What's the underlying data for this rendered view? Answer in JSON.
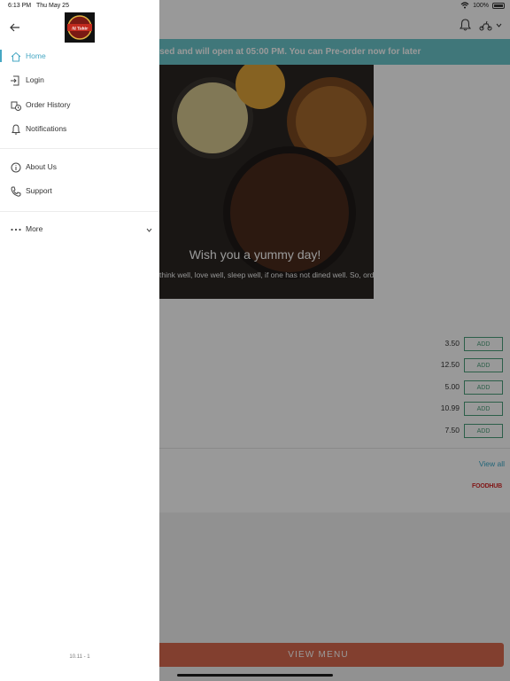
{
  "status_bar": {
    "time": "6:13 PM",
    "date": "Thu May 25",
    "battery": "100%"
  },
  "banner": {
    "text": "osed and will open at 05:00 PM. You can Pre-order now for later"
  },
  "hero": {
    "title": "Wish you a yummy day!",
    "subtitle": "think well, love well, sleep well, if one has not dined well. So, ord"
  },
  "menu_items": [
    {
      "price": "3.50",
      "button": "ADD"
    },
    {
      "price": "12.50",
      "button": "ADD"
    },
    {
      "price": "5.00",
      "button": "ADD"
    },
    {
      "price": "10.99",
      "button": "ADD"
    },
    {
      "price": "7.50",
      "button": "ADD"
    }
  ],
  "view_all": "View all",
  "brand": "FOODHUB",
  "view_menu": "VIEW MENU",
  "logo_text": "Al Tahir",
  "drawer": {
    "items": [
      {
        "label": "Home",
        "icon": "home-icon"
      },
      {
        "label": "Login",
        "icon": "login-icon"
      },
      {
        "label": "Order History",
        "icon": "order-history-icon"
      },
      {
        "label": "Notifications",
        "icon": "bell-icon"
      },
      {
        "label": "About Us",
        "icon": "info-icon"
      },
      {
        "label": "Support",
        "icon": "phone-icon"
      },
      {
        "label": "More",
        "icon": "more-dots-icon"
      }
    ],
    "version": "10.11 - 1"
  },
  "colors": {
    "accent": "#46a7c3",
    "banner": "#6cc7cb",
    "view_menu": "#d96a4f",
    "add_green": "#4a9e7a"
  }
}
